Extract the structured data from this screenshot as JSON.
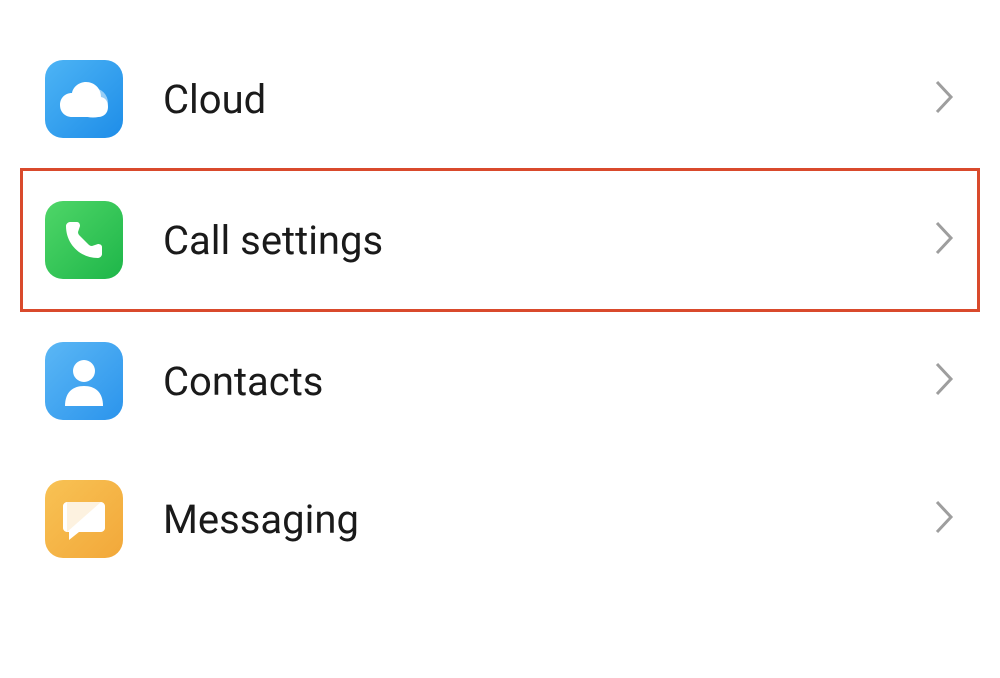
{
  "settings": {
    "items": [
      {
        "label": "Cloud",
        "highlighted": false
      },
      {
        "label": "Call settings",
        "highlighted": true
      },
      {
        "label": "Contacts",
        "highlighted": false
      },
      {
        "label": "Messaging",
        "highlighted": false
      }
    ]
  }
}
